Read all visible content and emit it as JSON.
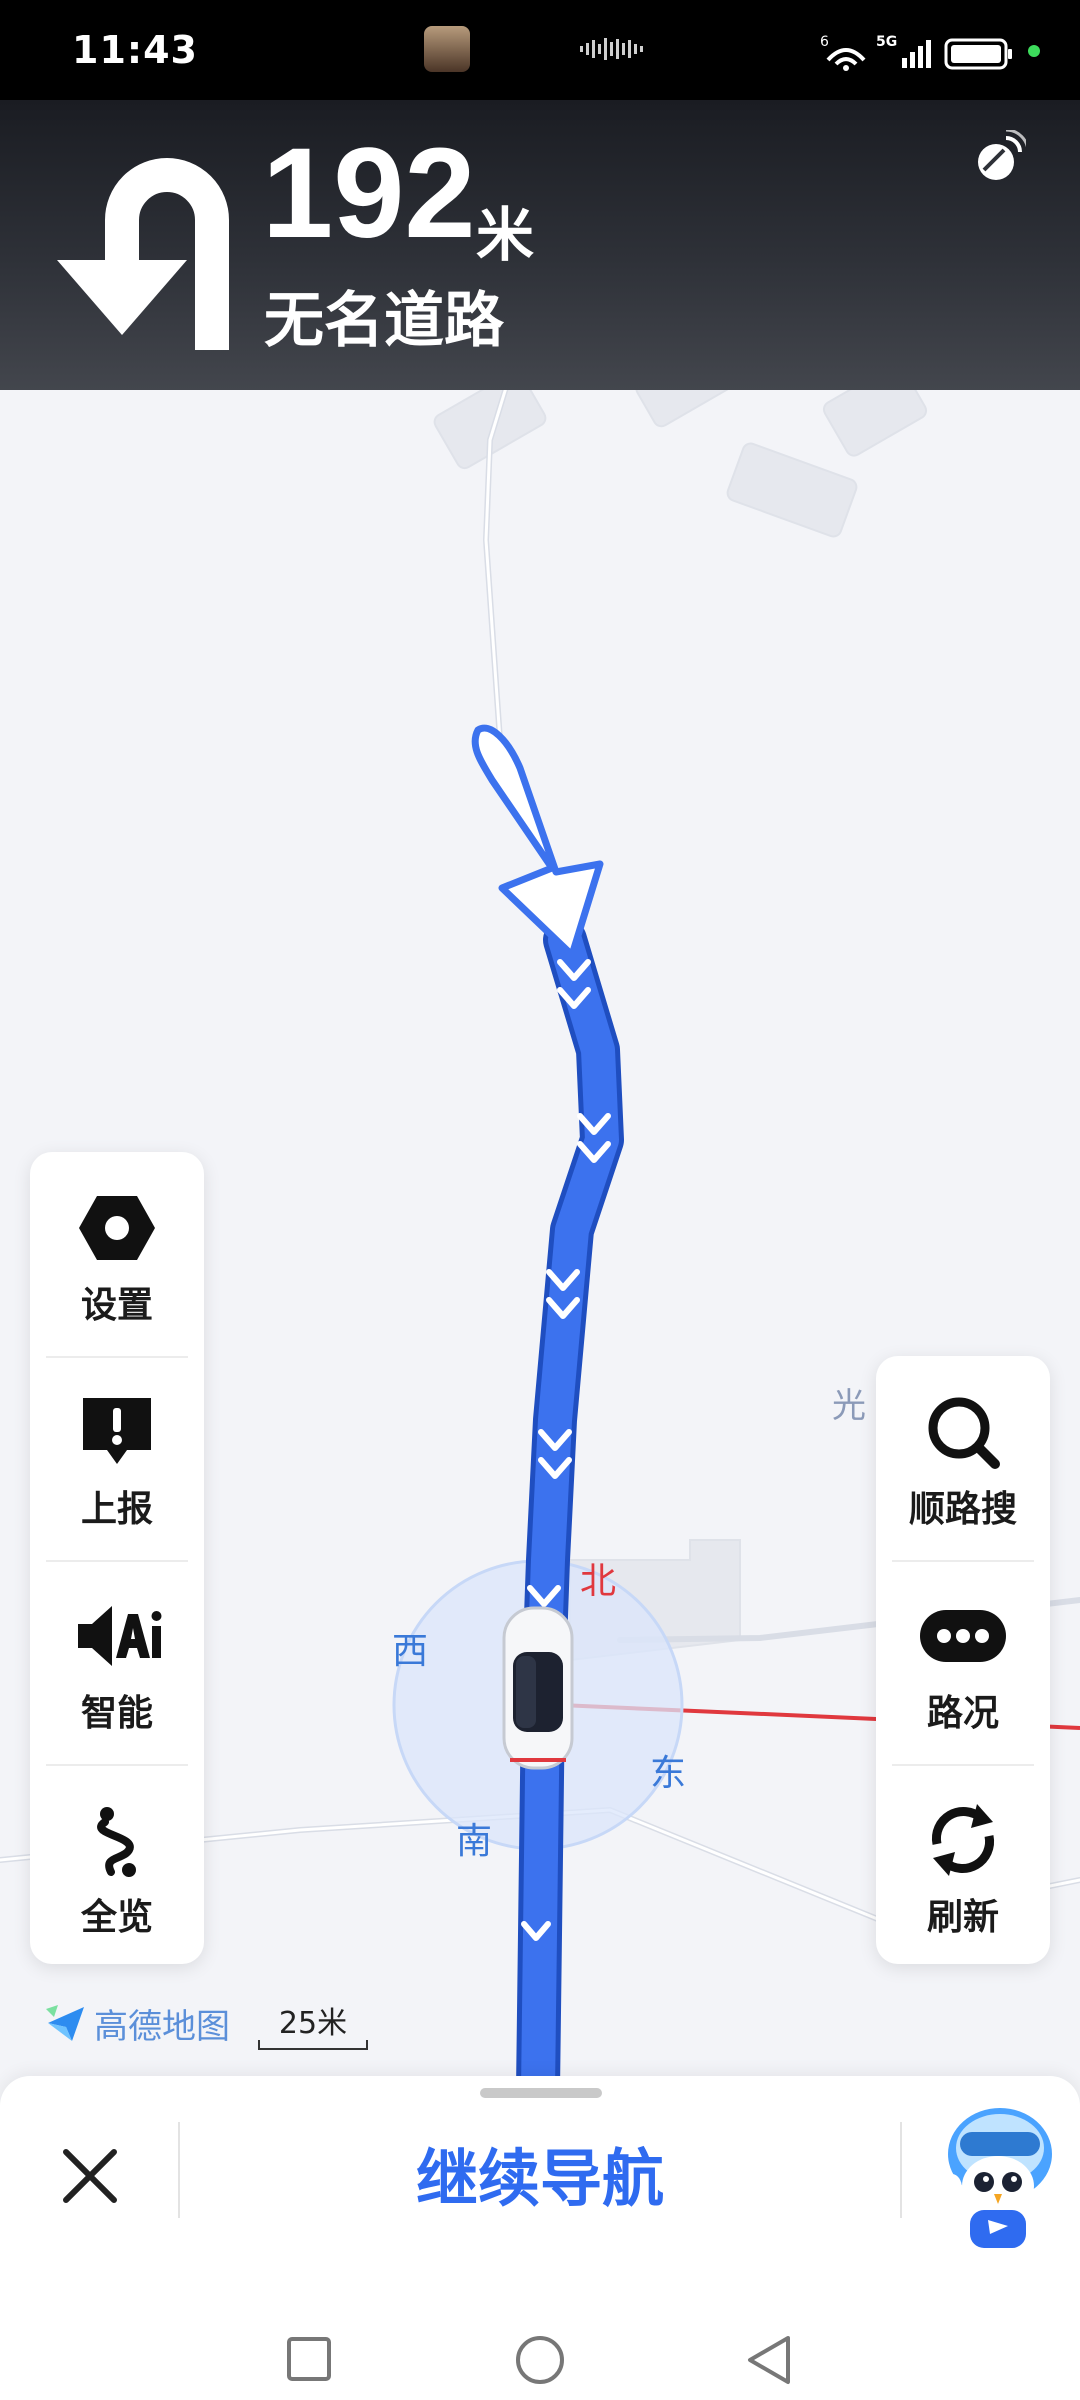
{
  "status_bar": {
    "time": "11:43",
    "network_type": "5G"
  },
  "navigation": {
    "maneuver_icon": "u-turn-icon",
    "distance_value": "192",
    "distance_unit": "米",
    "road_name": "无名道路"
  },
  "map": {
    "compass": {
      "north": "北",
      "south": "南",
      "east": "东",
      "west": "西"
    },
    "street_label": "光",
    "route_color": "#3c72ee",
    "accent_red": "#e0383e"
  },
  "left_panel": [
    {
      "label": "设置",
      "icon": "settings-hex-icon"
    },
    {
      "label": "上报",
      "icon": "report-alert-icon"
    },
    {
      "label": "智能",
      "icon": "ai-voice-icon"
    },
    {
      "label": "全览",
      "icon": "route-overview-icon"
    }
  ],
  "right_panel": [
    {
      "label": "顺路搜",
      "icon": "search-icon"
    },
    {
      "label": "路况",
      "icon": "traffic-more-icon"
    },
    {
      "label": "刷新",
      "icon": "refresh-icon"
    }
  ],
  "footer": {
    "brand": "高德地图",
    "scale": "25米"
  },
  "bottom_sheet": {
    "continue_label": "继续导航"
  }
}
